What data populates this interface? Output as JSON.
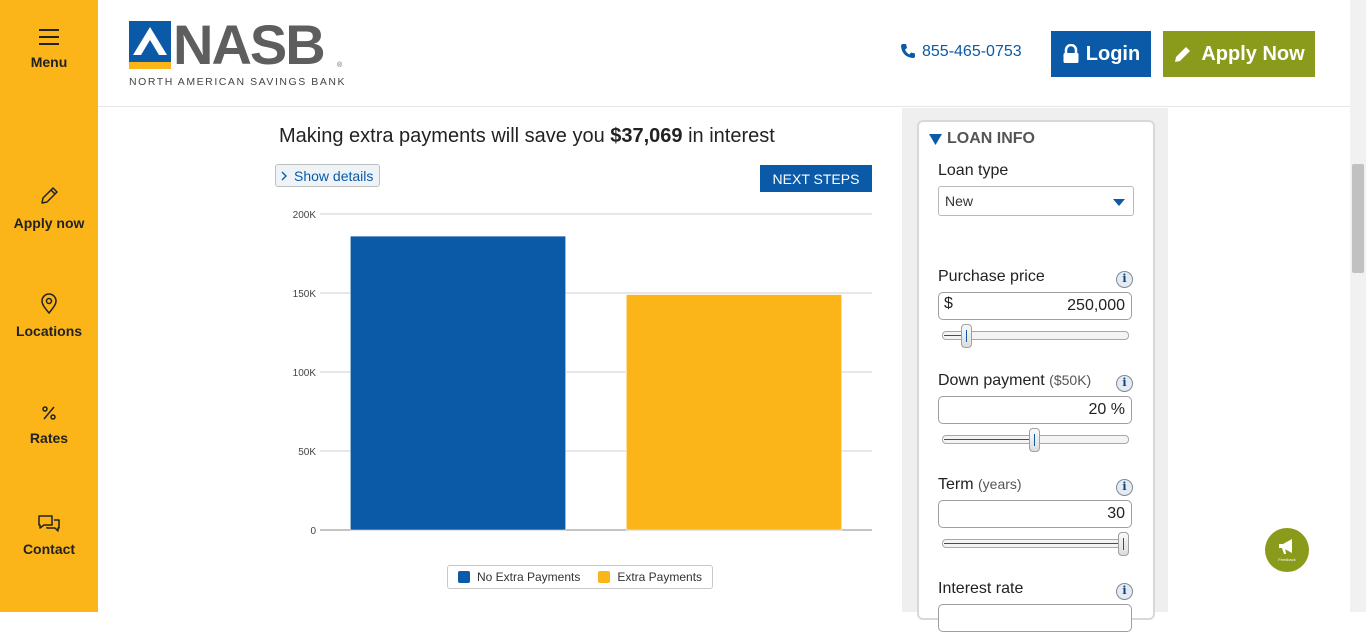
{
  "leftnav": {
    "menu": "Menu",
    "apply": "Apply now",
    "locations": "Locations",
    "rates": "Rates",
    "contact": "Contact"
  },
  "header": {
    "logo_word": "NASB",
    "logo_reg": "®",
    "logo_sub": "NORTH AMERICAN SAVINGS BANK",
    "phone": "855-465-0753",
    "login": "Login",
    "apply_now": "Apply Now"
  },
  "main": {
    "headline_pre": "Making extra payments will save you ",
    "headline_amount": "$37,069",
    "headline_post": " in interest",
    "show_details": "Show details",
    "next_steps": "NEXT STEPS"
  },
  "chart_data": {
    "type": "bar",
    "categories": [
      "No Extra Payments",
      "Extra Payments"
    ],
    "values": [
      186000,
      149000
    ],
    "colors": [
      "#0a5aa8",
      "#fbb519"
    ],
    "ylim": [
      0,
      200000
    ],
    "yticks": [
      0,
      50000,
      100000,
      150000,
      200000
    ],
    "ytick_labels": [
      "0",
      "50K",
      "100K",
      "150K",
      "200K"
    ],
    "grid": true,
    "legend": "bottom"
  },
  "loan_info": {
    "title": "LOAN INFO",
    "loan_type_label": "Loan type",
    "loan_type_value": "New",
    "purchase_label": "Purchase price",
    "purchase_prefix": "$",
    "purchase_value": "250,000",
    "purchase_slider": 0.1,
    "down_label": "Down payment",
    "down_sub": "($50K)",
    "down_value": "20 %",
    "down_slider": 0.49,
    "term_label": "Term",
    "term_sub": "(years)",
    "term_value": "30",
    "term_slider": 1.0,
    "rate_label": "Interest rate",
    "info_glyph": "i"
  },
  "feedback_label": "Feedback"
}
